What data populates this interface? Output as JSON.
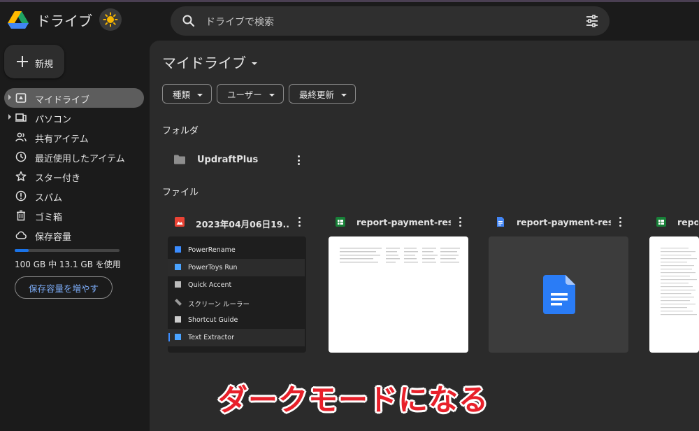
{
  "app": {
    "title": "ドライブ"
  },
  "search": {
    "placeholder": "ドライブで検索"
  },
  "sidebar": {
    "new_label": "新規",
    "items": [
      {
        "label": "マイドライブ",
        "icon": "my-drive-icon",
        "active": true,
        "expandable": true
      },
      {
        "label": "パソコン",
        "icon": "computers-icon",
        "active": false,
        "expandable": true
      },
      {
        "label": "共有アイテム",
        "icon": "shared-icon",
        "active": false,
        "expandable": false
      },
      {
        "label": "最近使用したアイテム",
        "icon": "recent-icon",
        "active": false,
        "expandable": false
      },
      {
        "label": "スター付き",
        "icon": "star-icon",
        "active": false,
        "expandable": false
      },
      {
        "label": "スパム",
        "icon": "spam-icon",
        "active": false,
        "expandable": false
      },
      {
        "label": "ゴミ箱",
        "icon": "trash-icon",
        "active": false,
        "expandable": false
      },
      {
        "label": "保存容量",
        "icon": "cloud-icon",
        "active": false,
        "expandable": false
      }
    ],
    "storage": {
      "used_fraction": 0.131,
      "text": "100 GB 中 13.1 GB を使用",
      "button_label": "保存容量を増やす"
    }
  },
  "main": {
    "title": "マイドライブ",
    "filters": [
      {
        "label": "種類"
      },
      {
        "label": "ユーザー"
      },
      {
        "label": "最終更新"
      }
    ],
    "folders_label": "フォルダ",
    "folders": [
      {
        "name": "UpdraftPlus",
        "icon": "folder-icon"
      }
    ],
    "files_label": "ファイル",
    "files": [
      {
        "name": "2023年04月06日19...",
        "icon": "image-icon",
        "color": "#ea4335",
        "thumb": "powertoys"
      },
      {
        "name": "report-payment-res...",
        "icon": "sheets-icon",
        "color": "#188038",
        "thumb": "sheet"
      },
      {
        "name": "report-payment-res...",
        "icon": "docs-icon",
        "color": "#4285f4",
        "thumb": "doc"
      },
      {
        "name": "report-payment-res...",
        "icon": "sheets-icon",
        "color": "#188038",
        "thumb": "sheet",
        "visible_text": "repo"
      }
    ],
    "powertoys_items": [
      "PowerRename",
      "PowerToys Run",
      "Quick Accent",
      "スクリーン ルーラー",
      "Shortcut Guide",
      "Text Extractor"
    ]
  },
  "overlay_caption": "ダークモードになる",
  "colors": {
    "background": "#1b1b1b",
    "panel": "#2b2b2b",
    "accent": "#1a73e8",
    "caption": "#e8202a"
  }
}
